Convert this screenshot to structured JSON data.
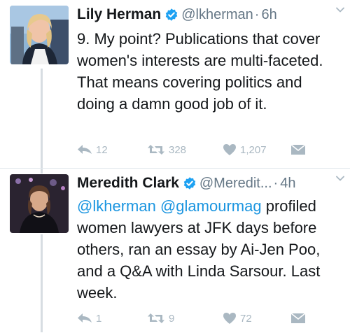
{
  "tweets": [
    {
      "name": "Lily Herman",
      "handle": "@lkherman",
      "separator": "·",
      "time": "6h",
      "text": "9. My point? Publications that cover women's interests are multi-faceted. That means covering politics and doing a damn good job of it.",
      "replies": "12",
      "retweets": "328",
      "likes": "1,207"
    },
    {
      "name": "Meredith Clark",
      "handle": "@Meredit...",
      "separator": "·",
      "time": "4h",
      "mention1": "@lkherman",
      "mention2": "@glamourmag",
      "text": "profiled women lawyers at JFK days before others, ran an essay by Ai-Jen Poo, and a Q&A with Linda Sarsour. Last week.",
      "replies": "1",
      "retweets": "9",
      "likes": "72"
    }
  ],
  "colors": {
    "verified": "#1da1f2",
    "mention": "#1b95e0",
    "icon_gray": "#aab8c2",
    "thread_line": "#d7dde2"
  }
}
